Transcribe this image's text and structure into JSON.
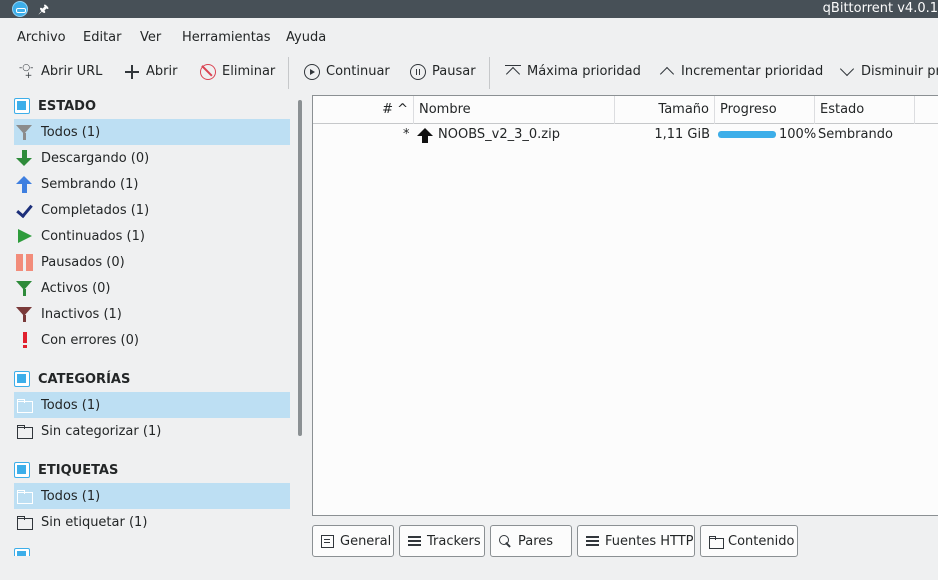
{
  "window": {
    "title": "qBittorrent v4.0.1"
  },
  "menubar": [
    "Archivo",
    "Editar",
    "Ver",
    "Herramientas",
    "Ayuda"
  ],
  "toolbar": {
    "open_url": "Abrir URL",
    "open": "Abrir",
    "delete": "Eliminar",
    "resume": "Continuar",
    "pause": "Pausar",
    "top_priority": "Máxima prioridad",
    "increase_priority": "Incrementar prioridad",
    "decrease_priority": "Disminuir pr"
  },
  "sidebar": {
    "status_header": "ESTADO",
    "status_items": [
      {
        "label": "Todos (1)",
        "icon": "filter-icon"
      },
      {
        "label": "Descargando (0)",
        "icon": "arrow-down-icon"
      },
      {
        "label": "Sembrando (1)",
        "icon": "arrow-up-icon"
      },
      {
        "label": "Completados (1)",
        "icon": "check-icon"
      },
      {
        "label": "Continuados (1)",
        "icon": "play-icon"
      },
      {
        "label": "Pausados (0)",
        "icon": "pause-icon"
      },
      {
        "label": "Activos (0)",
        "icon": "filter-icon"
      },
      {
        "label": "Inactivos (1)",
        "icon": "filter-icon"
      },
      {
        "label": "Con errores (0)",
        "icon": "exclamation-icon"
      }
    ],
    "categories_header": "CATEGORÍAS",
    "category_items": [
      "Todos (1)",
      "Sin categorizar (1)"
    ],
    "tags_header": "ETIQUETAS",
    "tag_items": [
      "Todos (1)",
      "Sin etiquetar (1)"
    ]
  },
  "torrent_list": {
    "columns": [
      "# ^",
      "Nombre",
      "Tamaño",
      "Progreso",
      "Estado"
    ],
    "rows": [
      {
        "queue": "*",
        "name": "NOOBS_v2_3_0.zip",
        "size": "1,11 GiB",
        "progress": 1.0,
        "progress_text": "100%",
        "status": "Sembrando"
      }
    ]
  },
  "tabs": [
    "General",
    "Trackers",
    "Pares",
    "Fuentes HTTP",
    "Contenido"
  ],
  "colors": {
    "accent": "#3daee9",
    "titlebar": "#475057",
    "selection": "#bddff3"
  }
}
